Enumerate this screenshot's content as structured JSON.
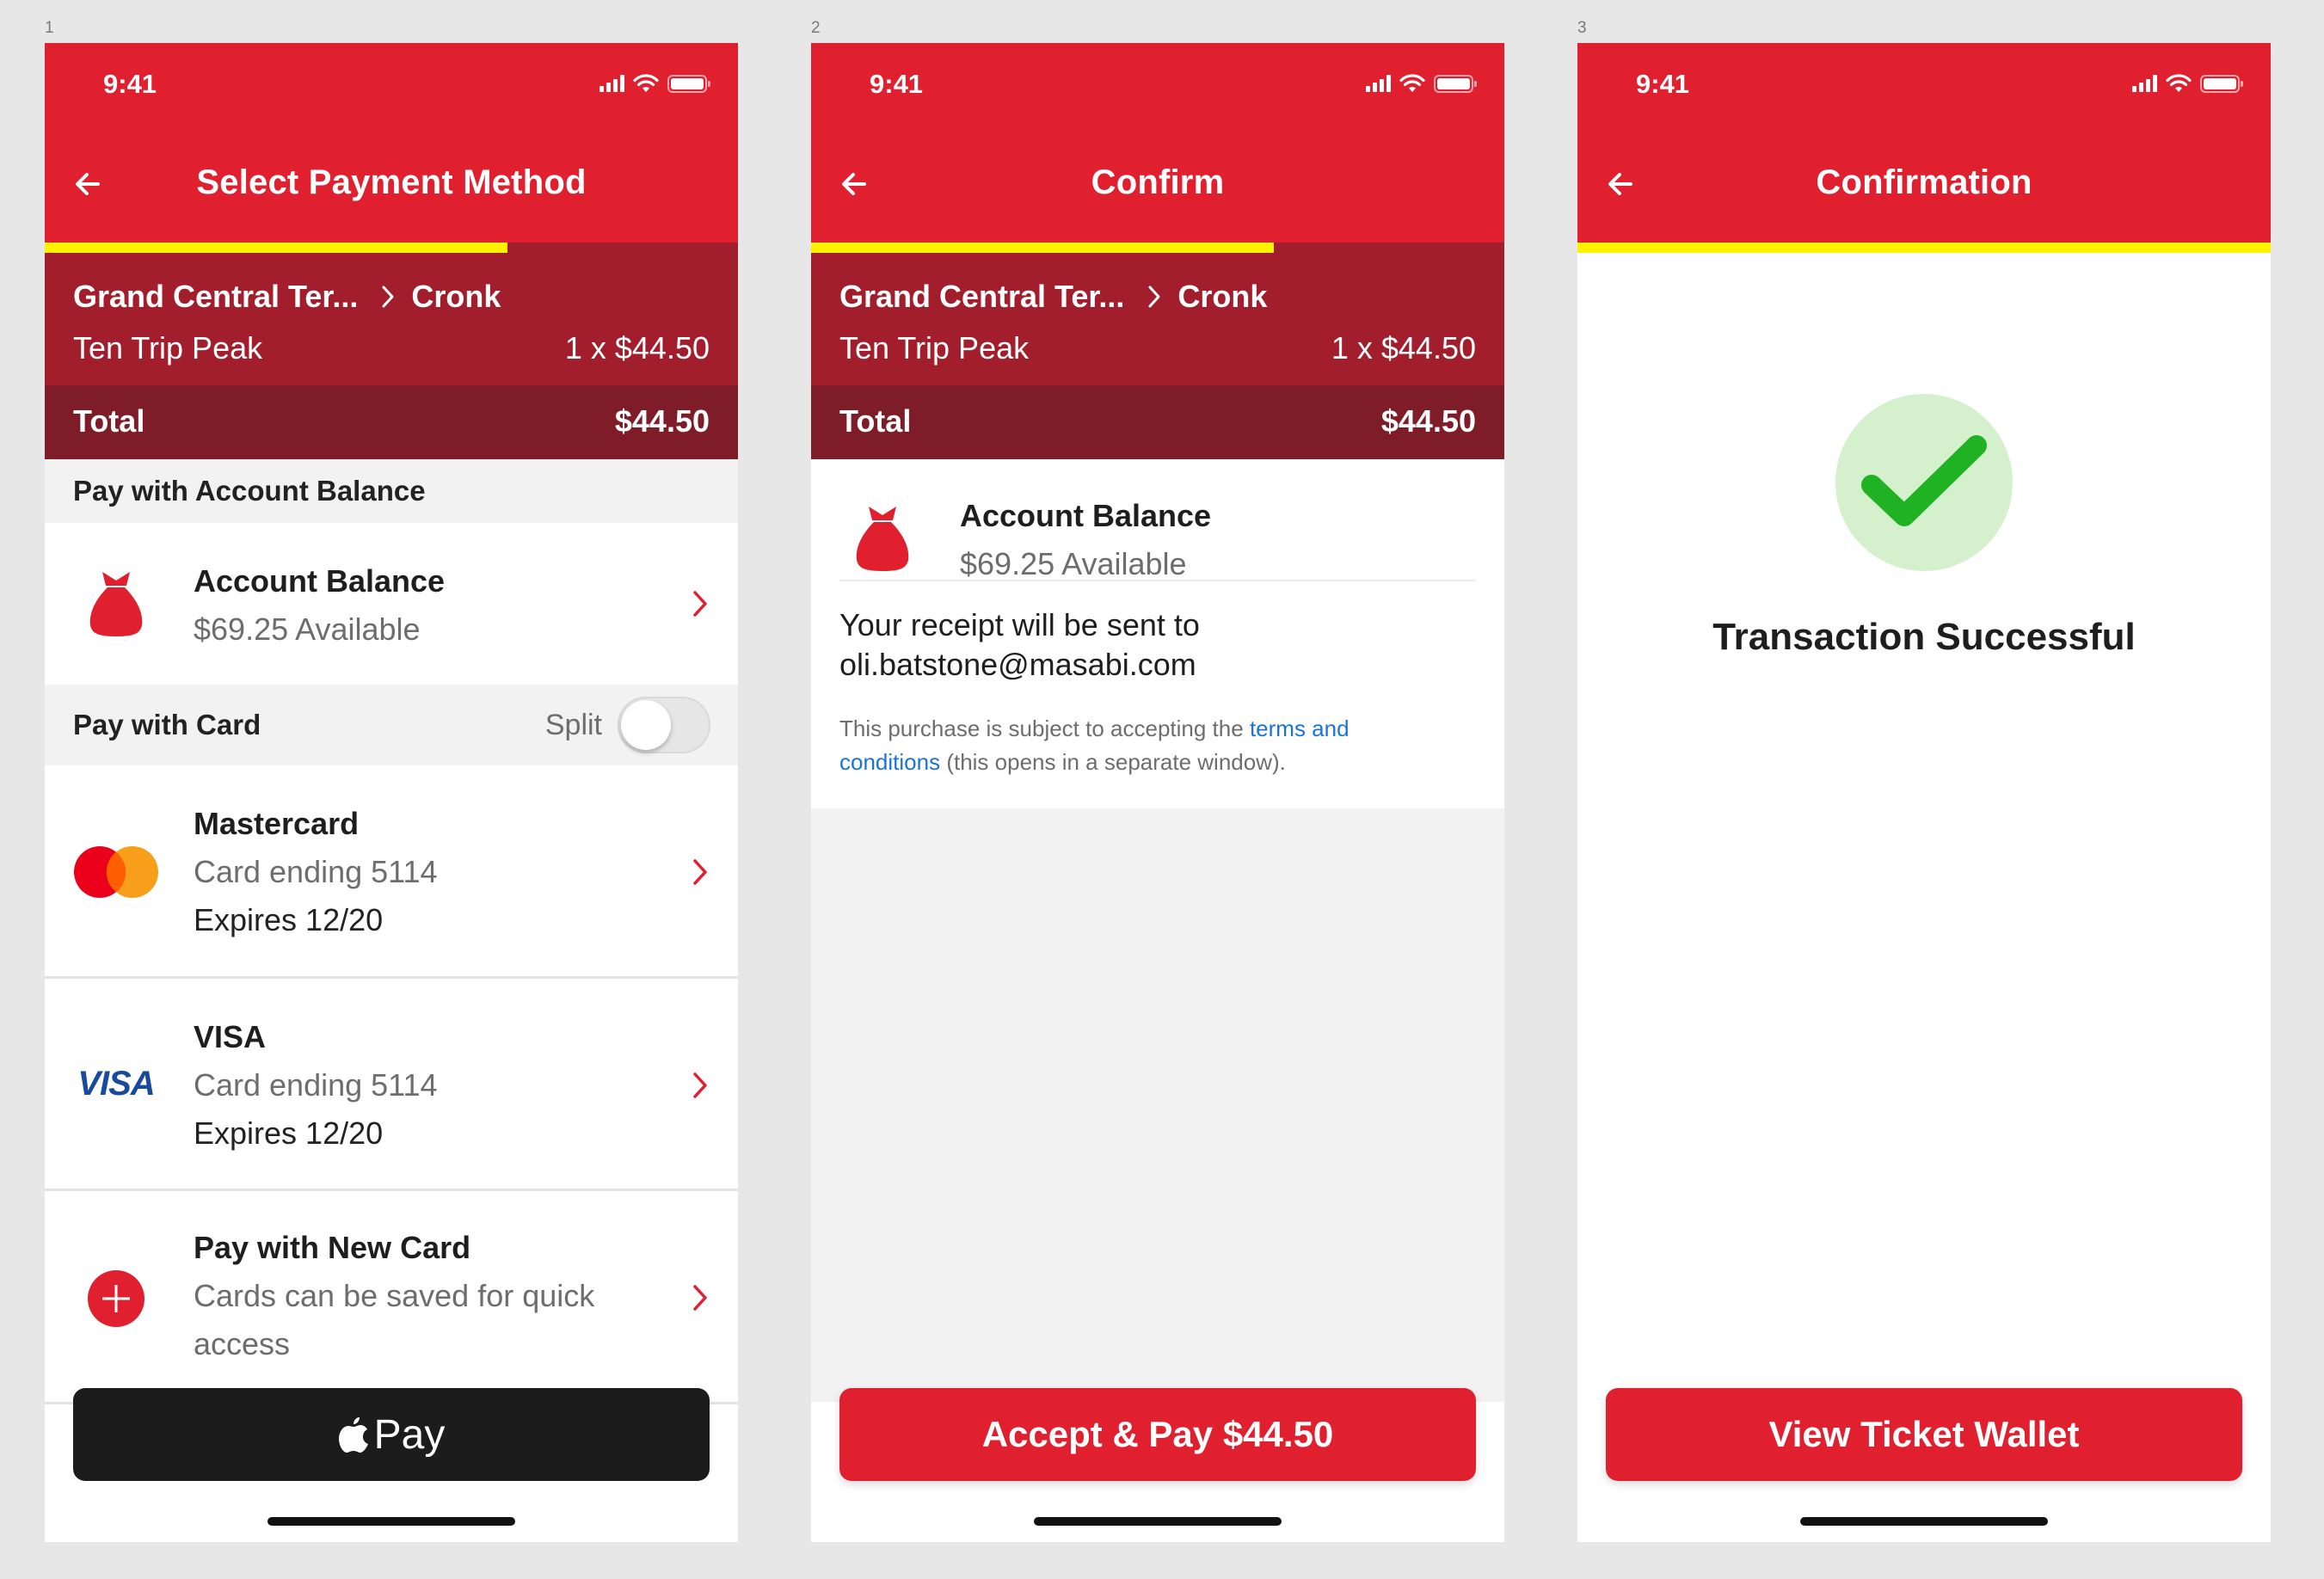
{
  "frames": [
    "1",
    "2",
    "3"
  ],
  "colors": {
    "brand_red": "#e01f2f",
    "summary_red": "#a21e2c",
    "total_red": "#7e1d28",
    "progress_yellow": "#fff200",
    "link_blue": "#1a73d9",
    "success_green": "#1fb323"
  },
  "status_bar": {
    "time": "9:41"
  },
  "trip": {
    "origin": "Grand Central Ter...",
    "destination": "Cronk",
    "ticket": "Ten Trip Peak",
    "price_line": "1 x $44.50",
    "total_label": "Total",
    "total_value": "$44.50"
  },
  "screen1": {
    "title": "Select Payment Method",
    "progress": 0.667,
    "section_balance": "Pay with Account Balance",
    "balance_item": {
      "title": "Account Balance",
      "subtitle": "$69.25 Available",
      "icon": "money-bag-icon"
    },
    "section_card": "Pay with Card",
    "split_label": "Split",
    "split_enabled": false,
    "cards": [
      {
        "title": "Mastercard",
        "ending": "Card ending 5114",
        "expiry": "Expires 12/20",
        "icon": "mastercard-icon"
      },
      {
        "title": "VISA",
        "ending": "Card ending 5114",
        "expiry": "Expires 12/20",
        "icon": "visa-icon",
        "logo_text": "VISA"
      }
    ],
    "new_card": {
      "title": "Pay with New Card",
      "subtitle_line1": "Cards can be saved for quick",
      "subtitle_line2": "access",
      "icon": "plus-circle-icon"
    },
    "apple_pay_label": "Pay"
  },
  "screen2": {
    "title": "Confirm",
    "progress": 0.667,
    "balance_item": {
      "title": "Account Balance",
      "subtitle": "$69.25 Available"
    },
    "receipt_line1": "Your receipt will be sent to",
    "receipt_email": "oli.batstone@masabi.com",
    "terms_prefix": "This purchase is subject to accepting the",
    "terms_link_1": "terms and",
    "terms_link_2": "conditions",
    "terms_suffix": "(this opens in a separate window).",
    "button_label": "Accept & Pay $44.50"
  },
  "screen3": {
    "title": "Confirmation",
    "progress": 1.0,
    "message": "Transaction Successful",
    "icon": "checkmark-icon",
    "button_label": "View Ticket Wallet"
  }
}
